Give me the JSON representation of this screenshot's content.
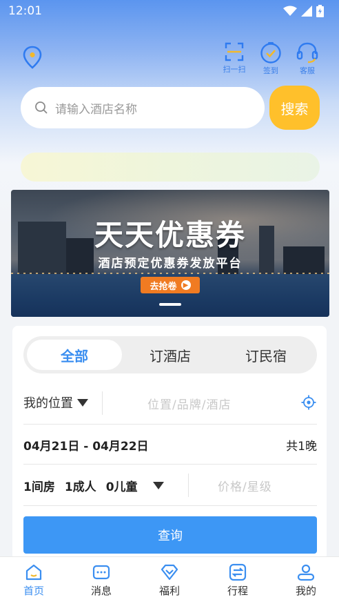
{
  "status_bar": {
    "time": "12:01"
  },
  "header": {
    "actions": [
      {
        "label": "扫一扫",
        "icon": "scan-icon"
      },
      {
        "label": "签到",
        "icon": "checkin-icon"
      },
      {
        "label": "客服",
        "icon": "headset-icon"
      }
    ]
  },
  "search": {
    "placeholder": "请输入酒店名称",
    "button_label": "搜索"
  },
  "banner": {
    "title": "天天优惠券",
    "subtitle": "酒店预定优惠券发放平台",
    "cta_label": "去抢卷"
  },
  "booking": {
    "tabs": [
      {
        "label": "全部",
        "active": true
      },
      {
        "label": "订酒店",
        "active": false
      },
      {
        "label": "订民宿",
        "active": false
      }
    ],
    "location_label": "我的位置",
    "location_placeholder": "位置/品牌/酒店",
    "date_range": "04月21日 - 04月22日",
    "nights": "共1晚",
    "rooms": "1间房",
    "adults": "1成人",
    "children": "0儿童",
    "price_placeholder": "价格/星级",
    "query_label": "查询"
  },
  "bottom_nav": [
    {
      "label": "首页",
      "icon": "home-icon",
      "active": true
    },
    {
      "label": "消息",
      "icon": "message-icon",
      "active": false
    },
    {
      "label": "福利",
      "icon": "gift-icon",
      "active": false
    },
    {
      "label": "行程",
      "icon": "itinerary-icon",
      "active": false
    },
    {
      "label": "我的",
      "icon": "profile-icon",
      "active": false
    }
  ],
  "colors": {
    "accent_blue": "#3a8ef0",
    "search_button": "#ffc02b",
    "query_button": "#3d97f5",
    "banner_cta": "#f07b22"
  }
}
